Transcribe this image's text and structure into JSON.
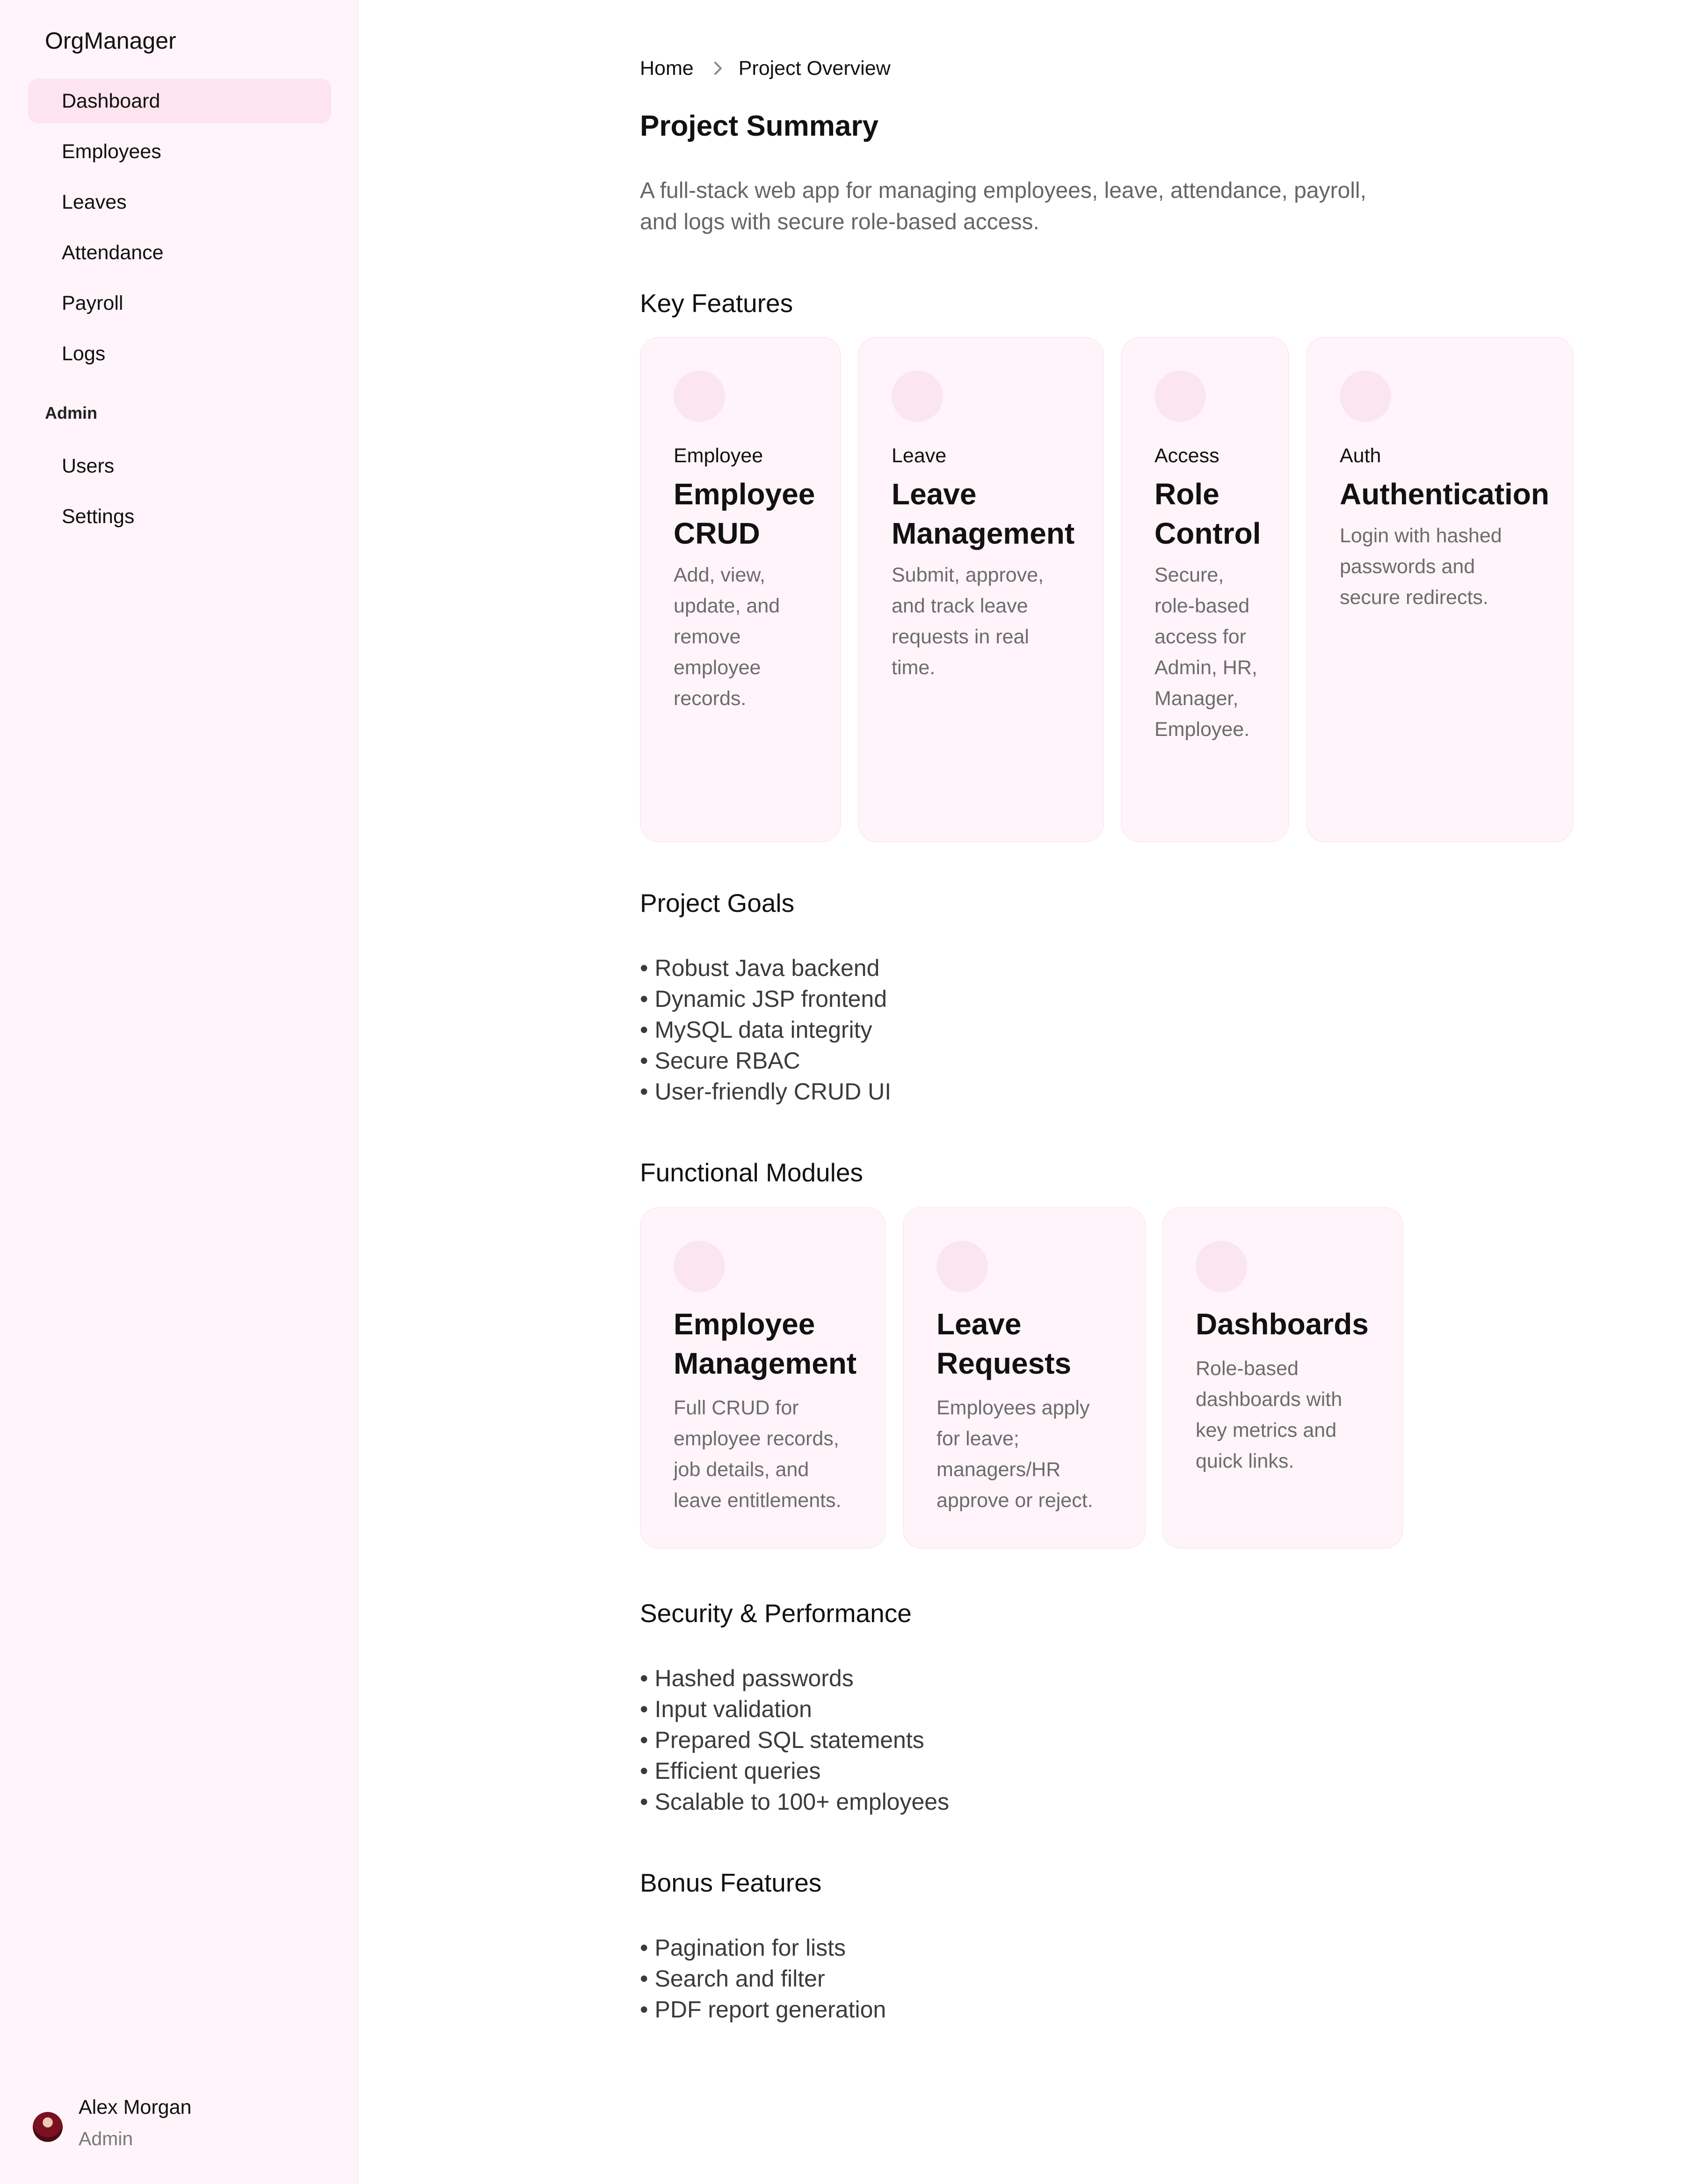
{
  "sidebar": {
    "brand": "OrgManager",
    "items": [
      {
        "label": "Dashboard",
        "active": true
      },
      {
        "label": "Employees"
      },
      {
        "label": "Leaves"
      },
      {
        "label": "Attendance"
      },
      {
        "label": "Payroll"
      },
      {
        "label": "Logs"
      }
    ],
    "admin_section_label": "Admin",
    "admin_items": [
      {
        "label": "Users"
      },
      {
        "label": "Settings"
      }
    ],
    "user": {
      "name": "Alex Morgan",
      "role": "Admin"
    }
  },
  "breadcrumb": {
    "home": "Home",
    "current": "Project Overview"
  },
  "main": {
    "title": "Project Summary",
    "summary": "A full-stack web app for managing employees, leave, attendance, payroll, and logs with secure role-based access.",
    "key_features": {
      "title": "Key Features",
      "cards": [
        {
          "eyebrow": "Employee",
          "title": "Employee CRUD",
          "desc": "Add, view, update, and remove employee records."
        },
        {
          "eyebrow": "Leave",
          "title": "Leave Management",
          "desc": "Submit, approve, and track leave requests in real time."
        },
        {
          "eyebrow": "Access",
          "title": "Role Control",
          "desc": "Secure, role-based access for Admin, HR, Manager, Employee."
        },
        {
          "eyebrow": "Auth",
          "title": "Authentication",
          "desc": "Login with hashed passwords and secure redirects."
        }
      ]
    },
    "goals": {
      "title": "Project Goals",
      "items": [
        "Robust Java backend",
        "Dynamic JSP frontend",
        "MySQL data integrity",
        "Secure RBAC",
        "User-friendly CRUD UI"
      ]
    },
    "modules": {
      "title": "Functional Modules",
      "cards": [
        {
          "title": "Employee Management",
          "desc": "Full CRUD for employee records, job details, and leave entitlements."
        },
        {
          "title": "Leave Requests",
          "desc": "Employees apply for leave; managers/HR approve or reject."
        },
        {
          "title": "Dashboards",
          "desc": "Role-based dashboards with key metrics and quick links."
        }
      ]
    },
    "security": {
      "title": "Security & Performance",
      "items": [
        "Hashed passwords",
        "Input validation",
        "Prepared SQL statements",
        "Efficient queries",
        "Scalable to 100+ employees"
      ]
    },
    "bonus": {
      "title": "Bonus Features",
      "items": [
        "Pagination for lists",
        "Search and filter",
        "PDF report generation"
      ]
    }
  },
  "colors": {
    "sidebar_bg": "#fff4f9",
    "active_nav_bg": "#fde4ee",
    "card_bg": "#fff4f9",
    "icon_circle": "#fbe6ef"
  },
  "icons": {
    "breadcrumb_separator": "chevron-right-icon",
    "card_icon": "placeholder-circle-icon",
    "avatar": "user-avatar"
  }
}
